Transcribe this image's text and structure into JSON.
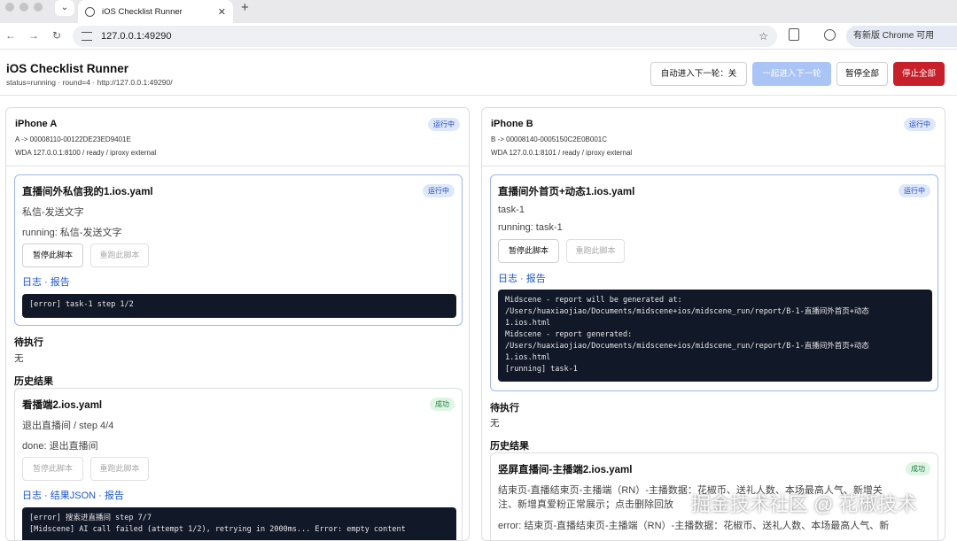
{
  "browser": {
    "tab_title": "iOS Checklist Runner",
    "url": "127.0.0.1:49290",
    "update_label": "有新版 Chrome 可用"
  },
  "header": {
    "title": "iOS Checklist Runner",
    "status": "status=running · round=4 · http://127.0.0.1:49290/",
    "auto_next": "自动进入下一轮：关",
    "next_together": "一起进入下一轮",
    "pause_all": "暂停全部",
    "stop_all": "停止全部"
  },
  "devices": [
    {
      "name": "iPhone A",
      "badge": "运行中",
      "id": "A -> 00008110-00122DE23ED9401E",
      "wda": "WDA 127.0.0.1:8100 / ready / iproxy external",
      "current": {
        "title": "直播间外私信我的1.ios.yaml",
        "badge": "运行中",
        "line1": "私信-发送文字",
        "line2": "running: 私信-发送文字",
        "pause": "暂停此脚本",
        "rerun": "重跑此脚本",
        "link_log": "日志",
        "link_report": "报告",
        "log": "[error] task-1 step 1/2"
      },
      "pending_label": "待执行",
      "pending_value": "无",
      "history_label": "历史结果",
      "history": {
        "title": "看播端2.ios.yaml",
        "badge": "成功",
        "line1": "退出直播间 / step 4/4",
        "line2": "done: 退出直播间",
        "pause": "暂停此脚本",
        "rerun": "重跑此脚本",
        "link_log": "日志",
        "link_json": "结果JSON",
        "link_report": "报告",
        "log": "[error] 搜索进直播间 step 7/7\n[Midscene] AI call failed (attempt 1/2), retrying in 2000ms... Error: empty content"
      }
    },
    {
      "name": "iPhone B",
      "badge": "运行中",
      "id": "B -> 00008140-0005150C2E0B001C",
      "wda": "WDA 127.0.0.1:8101 / ready / iproxy external",
      "current": {
        "title": "直播间外首页+动态1.ios.yaml",
        "badge": "运行中",
        "line1": "task-1",
        "line2": "running: task-1",
        "pause": "暂停此脚本",
        "rerun": "重跑此脚本",
        "link_log": "日志",
        "link_report": "报告",
        "log": "Midscene - report will be generated at:\n/Users/huaxiaojiao/Documents/midscene+ios/midscene_run/report/B-1-直播间外首页+动态\n1.ios.html\nMidscene - report generated:\n/Users/huaxiaojiao/Documents/midscene+ios/midscene_run/report/B-1-直播间外首页+动态\n1.ios.html\n[running] task-1"
      },
      "pending_label": "待执行",
      "pending_value": "无",
      "history_label": "历史结果",
      "history": {
        "title": "竖屏直播间-主播端2.ios.yaml",
        "badge": "成功",
        "line1": "结束页-直播结束页-主播端（RN）-主播数据：花椒币、送礼人数、本场最高人气、新增关",
        "line1b": "注、新增真爱粉正常展示；点击删除回放",
        "line2": "error: 结束页-直播结束页-主播端（RN）-主播数据：花椒币、送礼人数、本场最高人气、新"
      }
    }
  ],
  "watermark": "掘金技术社区 @ 花椒技术"
}
